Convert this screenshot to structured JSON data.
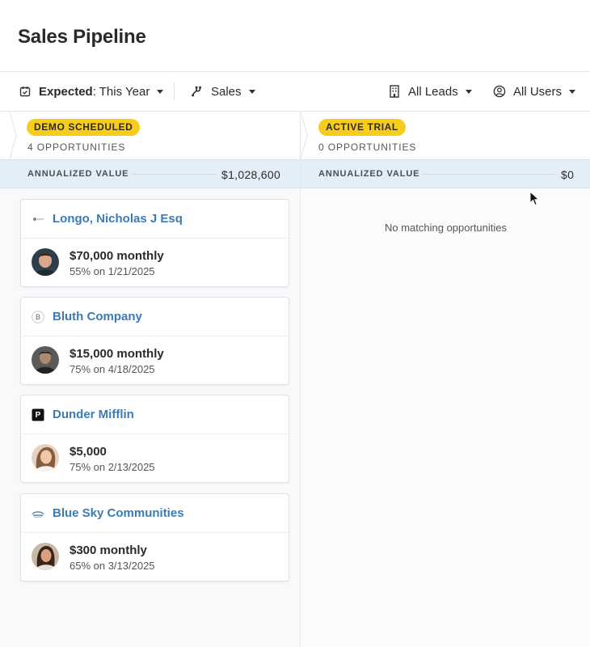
{
  "page": {
    "title": "Sales Pipeline"
  },
  "filters": {
    "expected": {
      "label": "Expected",
      "value": ": This Year"
    },
    "pipeline": {
      "label": "Sales"
    },
    "leads": {
      "label": "All Leads"
    },
    "users": {
      "label": "All Users"
    }
  },
  "columns": [
    {
      "stage": "DEMO SCHEDULED",
      "count": "4 OPPORTUNITIES",
      "value_label": "ANNUALIZED VALUE",
      "value": "$1,028,600",
      "cards": [
        {
          "company": "Longo, Nicholas J Esq",
          "logo": "longo-logo",
          "amount": "$70,000 monthly",
          "probability": "55% on 1/21/2025"
        },
        {
          "company": "Bluth Company",
          "logo": "bluth-logo",
          "logo_letter": "B",
          "amount": "$15,000 monthly",
          "probability": "75% on 4/18/2025"
        },
        {
          "company": "Dunder Mifflin",
          "logo": "dunder-mifflin-logo",
          "logo_letter": "P",
          "amount": "$5,000",
          "probability": "75% on 2/13/2025"
        },
        {
          "company": "Blue Sky Communities",
          "logo": "blue-sky-logo",
          "amount": "$300 monthly",
          "probability": "65% on 3/13/2025"
        }
      ]
    },
    {
      "stage": "ACTIVE TRIAL",
      "count": "0 OPPORTUNITIES",
      "value_label": "ANNUALIZED VALUE",
      "value": "$0",
      "empty_message": "No matching opportunities"
    }
  ],
  "colors": {
    "badge": "#f8cc1b",
    "link": "#3b7bb4",
    "value_bar": "#e4eef8"
  }
}
